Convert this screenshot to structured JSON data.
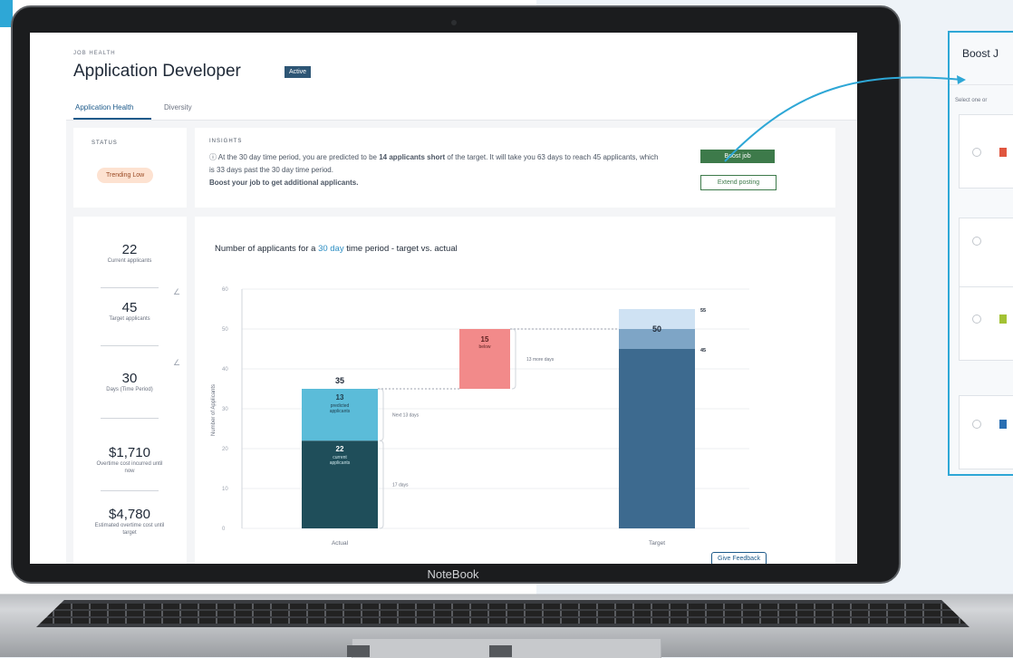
{
  "laptop": {
    "brand": "NoteBook"
  },
  "page": {
    "eyebrow": "JOB HEALTH",
    "title": "Application Developer",
    "badge": "Active",
    "tabs": [
      "Application Health",
      "Diversity"
    ]
  },
  "status": {
    "label": "STATUS",
    "value": "Trending Low"
  },
  "insights": {
    "label": "INSIGHTS",
    "text_pre": "At the 30 day time period, you are predicted to be ",
    "text_bold": "14 applicants short",
    "text_post": " of the target. It will take you 63 days to reach 45 applicants, which is 33 days past the 30 day time period.",
    "cta": "Boost your job to get additional applicants.",
    "boost_button": "Boost job",
    "extend_button": "Extend posting"
  },
  "metrics": [
    {
      "value": "22",
      "label": "Current applicants"
    },
    {
      "value": "45",
      "label": "Target applicants"
    },
    {
      "value": "30",
      "label": "Days (Time Period)"
    },
    {
      "value": "$1,710",
      "label": "Overtime cost incurred until now"
    },
    {
      "value": "$4,780",
      "label": "Estimated overtime cost until target"
    }
  ],
  "chart": {
    "title_pre": "Number of applicants for a ",
    "title_hl": "30 day",
    "title_post": " time period - target vs. actual",
    "feedback": "Give Feedback"
  },
  "chart_data": {
    "type": "bar",
    "ylabel": "Number of Applicants",
    "ylim": [
      0,
      60
    ],
    "yticks": [
      0,
      10,
      20,
      30,
      40,
      50,
      60
    ],
    "categories": [
      "Actual",
      "Target"
    ],
    "actual": {
      "total_label": "35",
      "segments": [
        {
          "value": 22,
          "label": "22",
          "sublabel": "current applicants",
          "color": "#1f4e5a"
        },
        {
          "value": 13,
          "label": "13",
          "sublabel": "predicted applicants",
          "color": "#5bbcd9"
        }
      ]
    },
    "gap": {
      "value": 15,
      "label": "15",
      "sublabel": "below",
      "from": 35,
      "to": 50,
      "color": "#f28a8a"
    },
    "target": {
      "segments": [
        {
          "value": 45,
          "color": "#3d6a8f"
        },
        {
          "value": 5,
          "color": "#7ea5c6"
        },
        {
          "value": 5,
          "color": "#cfe2f3"
        }
      ],
      "labels": [
        "50",
        "55",
        "45"
      ]
    },
    "annotations": [
      "17 days",
      "Next 13 days",
      "13 more days"
    ]
  },
  "boost_panel": {
    "title": "Boost J",
    "hint": "Select one or"
  }
}
